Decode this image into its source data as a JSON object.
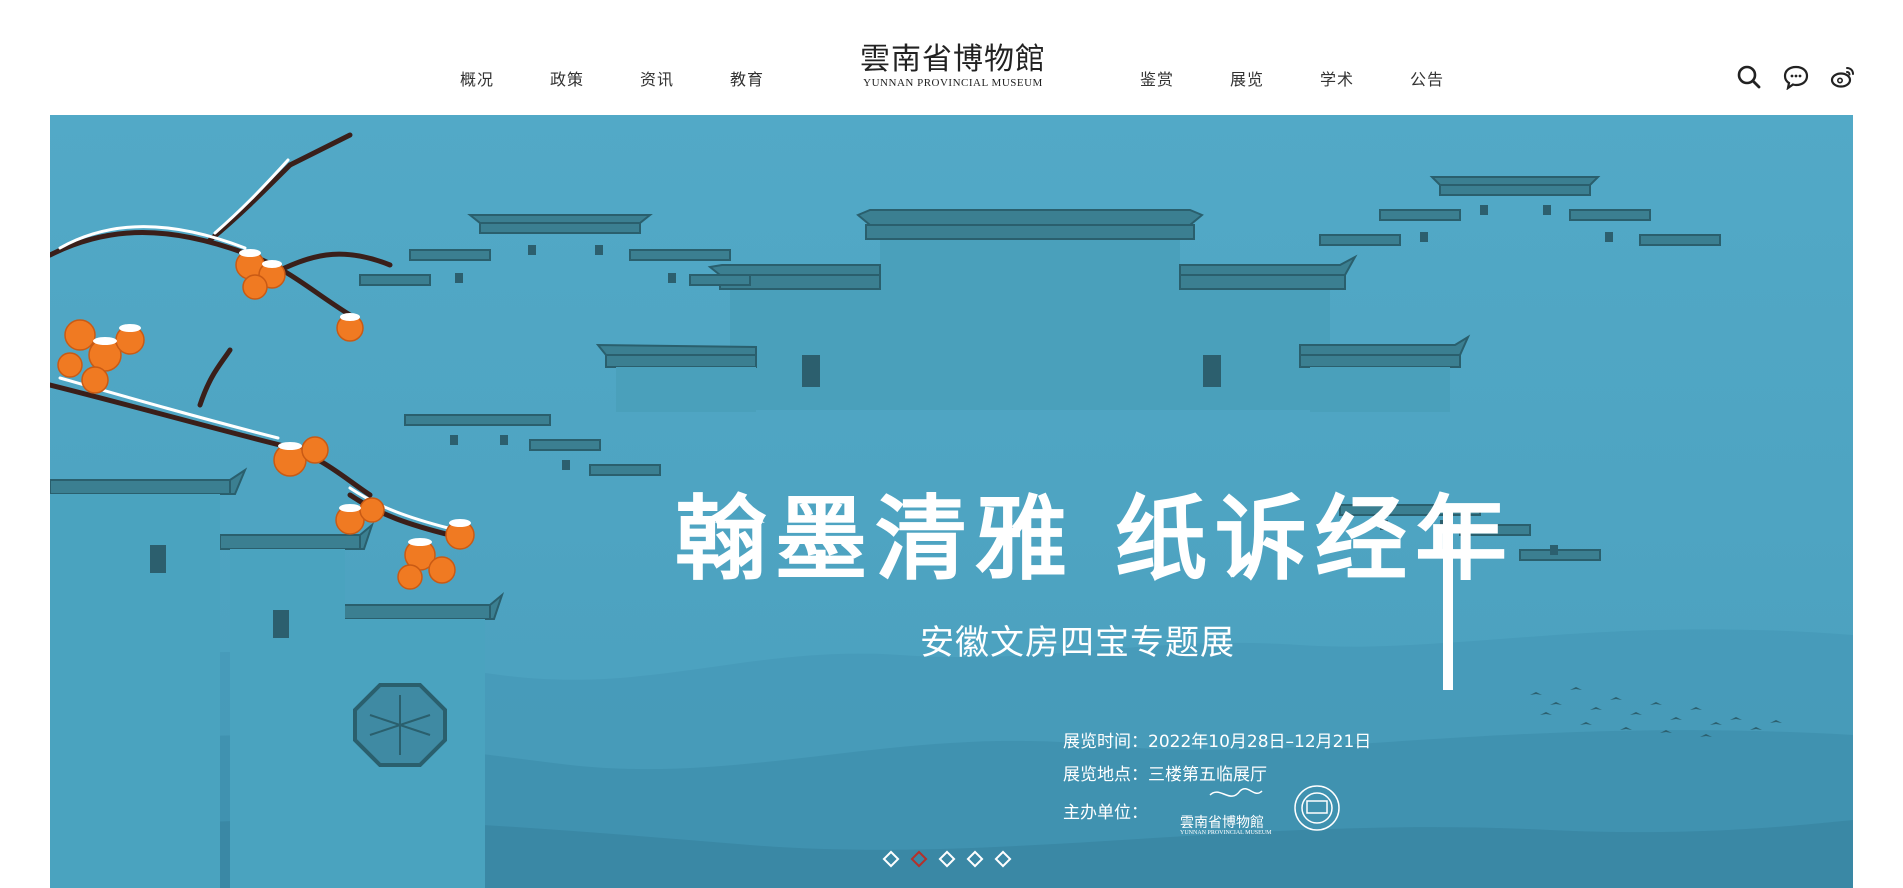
{
  "nav": {
    "left": [
      "概况",
      "政策",
      "资讯",
      "教育"
    ],
    "right": [
      "鉴赏",
      "展览",
      "学术",
      "公告"
    ]
  },
  "logo": {
    "cn": "雲南省博物館",
    "en": "YUNNAN PROVINCIAL MUSEUM"
  },
  "tools": [
    "search-icon",
    "chat-icon",
    "weibo-icon"
  ],
  "banner": {
    "title": "翰墨清雅 纸诉经年",
    "subtitle": "安徽文房四宝专题展",
    "time": "展览时间：2022年10月28日–12月21日",
    "place": "展览地点：三楼第五临展厅",
    "organizer": "主办单位：",
    "organizer_logo_en": "YUNNAN PROVINCIAL MUSEUM",
    "organizer_logo_cn": "雲南省博物館"
  },
  "carousel": {
    "count": 5,
    "active_index": 1
  },
  "colors": {
    "banner_bg": "#4fa8c6",
    "roof": "#2f6f80",
    "persimmon": "#f07a22",
    "active_dot": "#b5302b"
  }
}
